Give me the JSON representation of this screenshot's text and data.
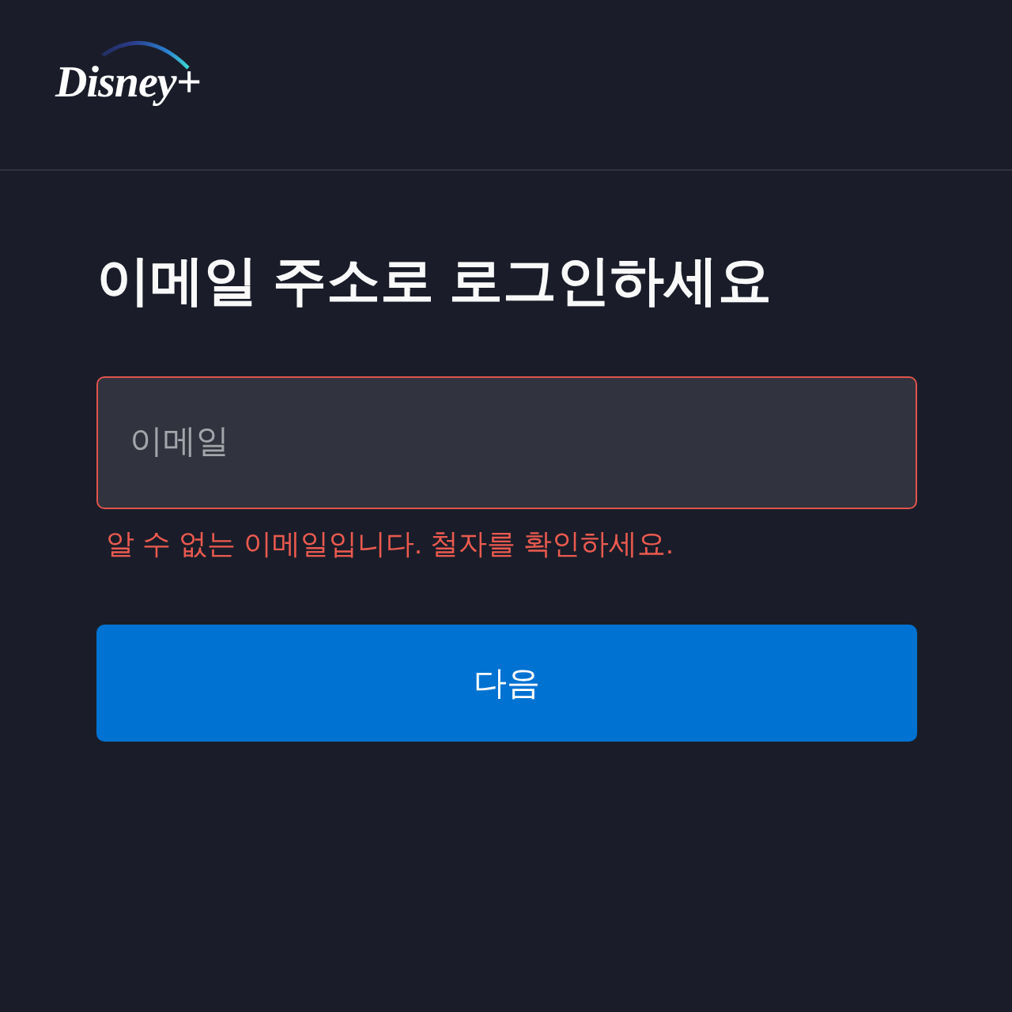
{
  "header": {
    "logo": {
      "text": "Disney+"
    }
  },
  "title": "이메일 주소로 로그인하세요",
  "email_field": {
    "placeholder": "이메일",
    "error": true,
    "error_message": "알 수 없는 이메일입니다. 철자를 확인하세요."
  },
  "buttons": [
    {
      "label": "다음",
      "kind": "primary"
    }
  ]
}
